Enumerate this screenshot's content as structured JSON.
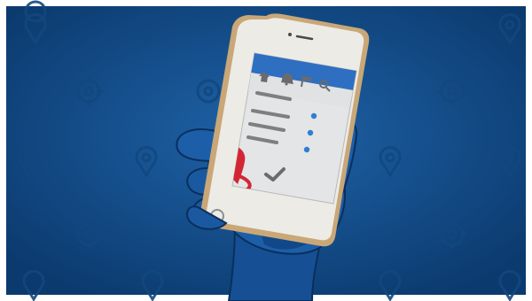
{
  "scene": {
    "kind": "illustration",
    "colors": {
      "frame": "#ffffff",
      "background_light": "#1f63a8",
      "background_dark": "#0b3a6e",
      "pattern": "#12487f",
      "hand": "#1c5ea8",
      "hand_shadow": "#0d3f7c",
      "phone_body": "#ecebe6",
      "phone_gold": "#c9a777",
      "screen": "#e4e5e6",
      "header": "#2f6fc1",
      "menu_lines": "#7f7f7f",
      "dots": "#2f7fd1",
      "pin": "#d32635",
      "check": "#6c6c6c"
    },
    "icons": [
      "location-pin-pattern-icon",
      "target-pattern-icon",
      "home-icon",
      "bell-icon",
      "flag-icon",
      "search-icon",
      "location-pin-icon",
      "checkmark-icon",
      "x-mark-icon",
      "home-button-icon"
    ]
  }
}
